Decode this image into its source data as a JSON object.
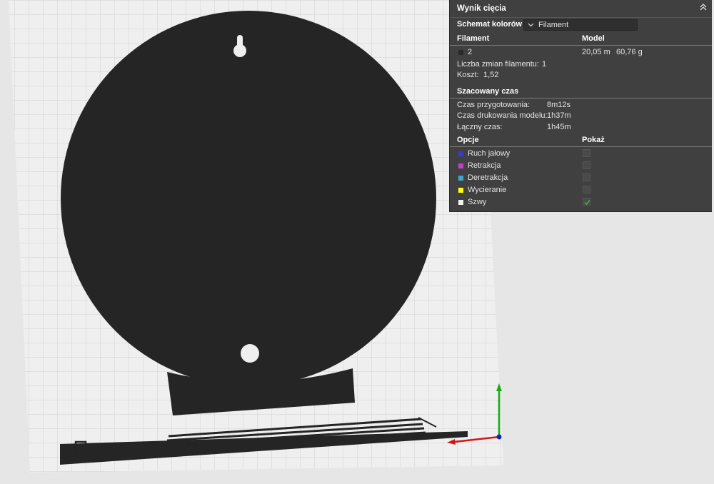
{
  "panel": {
    "title": "Wynik cięcia",
    "color_scheme_label": "Schemat kolorów",
    "color_scheme_value": "Filament",
    "filament_header": "Filament",
    "model_header": "Model",
    "filament_row": {
      "id": "2",
      "length": "20,05 m",
      "weight": "60,76 g",
      "swatch_color": "#2a2a2a"
    },
    "filament_changes_label": "Liczba zmian filamentu:",
    "filament_changes_value": "1",
    "cost_label": "Koszt:",
    "cost_value": "1,52",
    "estimated_time_header": "Szacowany czas",
    "prep_time_label": "Czas przygotowania:",
    "prep_time_value": "8m12s",
    "model_print_time_label": "Czas drukowania modelu:",
    "model_print_time_value": "1h37m",
    "total_time_label": "Łączny czas:",
    "total_time_value": "1h45m",
    "options_header": "Opcje",
    "show_header": "Pokaż",
    "options": [
      {
        "label": "Ruch jałowy",
        "color": "#3a3ad0",
        "checked": false
      },
      {
        "label": "Retrakcja",
        "color": "#c040c8",
        "checked": false
      },
      {
        "label": "Deretrakcja",
        "color": "#3ea6c8",
        "checked": false
      },
      {
        "label": "Wycieranie",
        "color": "#ffff00",
        "checked": false
      },
      {
        "label": "Szwy",
        "color": "#f2f2f2",
        "checked": true
      }
    ]
  },
  "scene": {
    "bed_color": "#efefef",
    "grid_color": "#d2d2d2",
    "model_color": "#252525",
    "axis_colors": {
      "x": "#d01818",
      "y": "#10b010",
      "z": "#1020c0"
    }
  }
}
